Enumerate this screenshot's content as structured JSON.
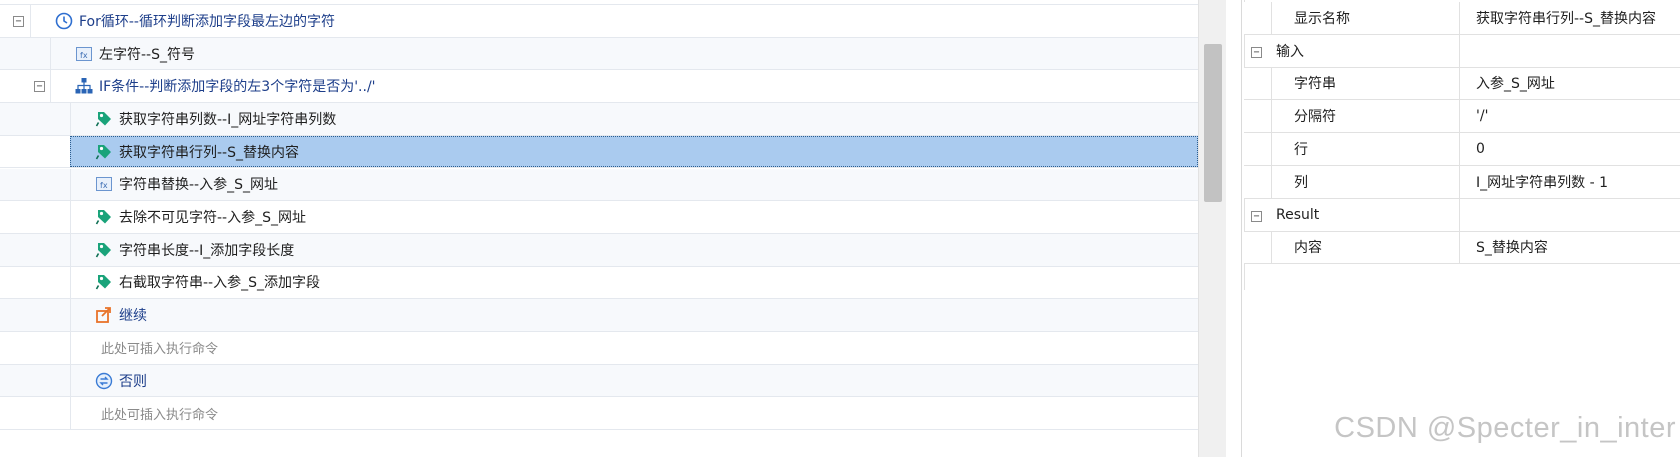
{
  "tree": {
    "rows": [
      {
        "label": "For循环--循环判断添加字段最左边的字符",
        "icon": "clock-icon",
        "toggle": "⊟",
        "blue": true
      },
      {
        "label": "左字符--S_符号",
        "icon": "function-icon"
      },
      {
        "label": "IF条件--判断添加字段的左3个字符是否为'../'",
        "icon": "branch-icon",
        "toggle": "⊟",
        "blue": true
      },
      {
        "label": "获取字符串列数--I_网址字符串列数",
        "icon": "tag-icon"
      },
      {
        "label": "获取字符串行列--S_替换内容",
        "icon": "tag-icon",
        "selected": true
      },
      {
        "label": "字符串替换--入参_S_网址",
        "icon": "function-icon"
      },
      {
        "label": "去除不可见字符--入参_S_网址",
        "icon": "tag-icon"
      },
      {
        "label": "字符串长度--I_添加字段长度",
        "icon": "tag-icon"
      },
      {
        "label": "右截取字符串--入参_S_添加字段",
        "icon": "tag-icon"
      },
      {
        "label": "继续",
        "icon": "continue-icon",
        "blue": true
      },
      {
        "label": "此处可插入执行命令",
        "placeholder": true
      },
      {
        "label": "否则",
        "icon": "else-icon",
        "blue": true
      },
      {
        "label": "此处可插入执行命令",
        "placeholder": true
      }
    ]
  },
  "properties": {
    "rows": [
      {
        "name": "显示名称",
        "value": "获取字符串行列--S_替换内容"
      },
      {
        "name": "输入",
        "value": "",
        "group": true,
        "toggle": "−"
      },
      {
        "name": "字符串",
        "value": "入参_S_网址"
      },
      {
        "name": "分隔符",
        "value": "'/'"
      },
      {
        "name": "行",
        "value": "0"
      },
      {
        "name": "列",
        "value": "I_网址字符串列数 - 1"
      },
      {
        "name": "Result",
        "value": "",
        "group": true,
        "toggle": "−"
      },
      {
        "name": "内容",
        "value": "S_替换内容"
      }
    ]
  },
  "watermark": "CSDN @Specter_in_inter",
  "colors": {
    "selection": "#aacbef",
    "blue_text": "#1d3e8a",
    "icon_green": "#1aa37a",
    "icon_orange": "#e8732a"
  }
}
